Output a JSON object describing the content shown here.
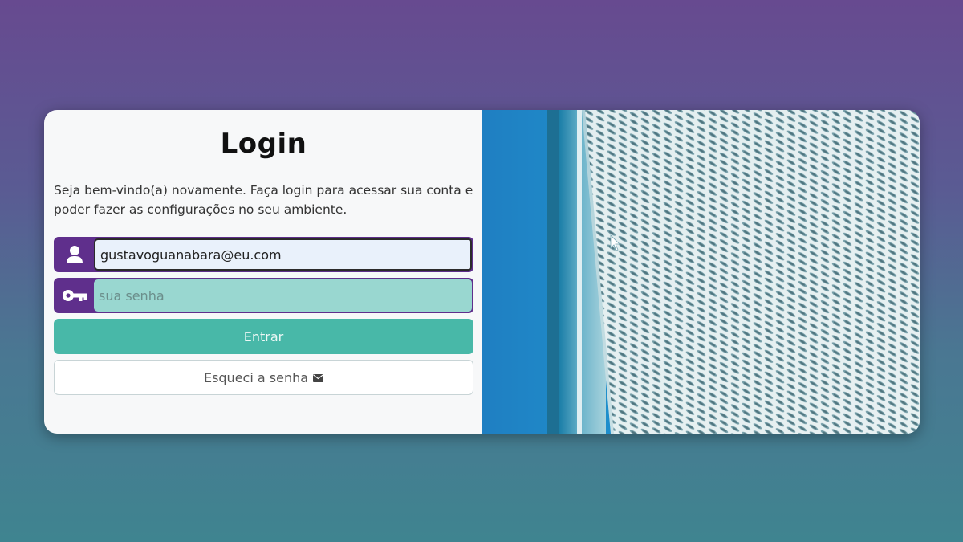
{
  "login": {
    "title": "Login",
    "intro": "Seja bem-vindo(a) novamente. Faça login para acessar sua conta e poder fazer as configurações no seu ambiente.",
    "email_value": "gustavoguanabara@eu.com",
    "password_placeholder": "sua senha",
    "submit_label": "Entrar",
    "forgot_label": "Esqueci a senha",
    "user_icon": "user-icon",
    "key_icon": "key-icon",
    "mail_icon": "envelope-icon"
  },
  "colors": {
    "accent_purple": "#5f2f8c",
    "primary_teal": "#48b8a8",
    "password_field": "#99d7d0"
  }
}
